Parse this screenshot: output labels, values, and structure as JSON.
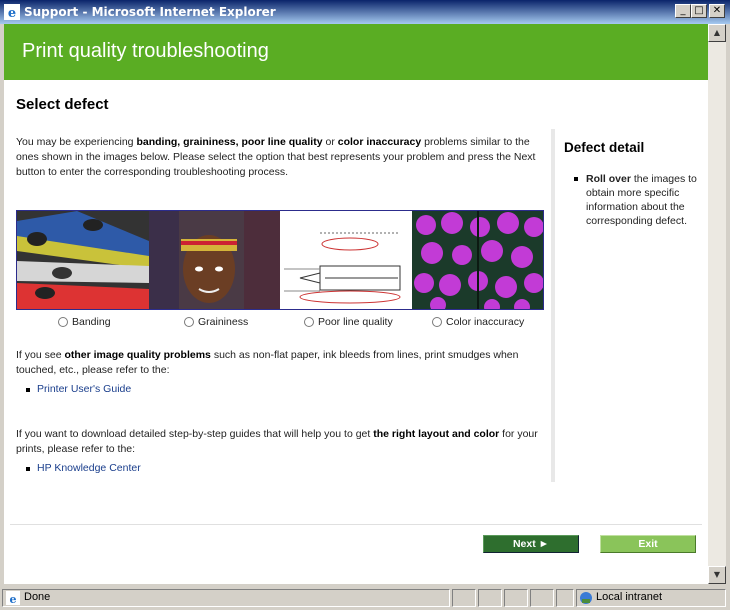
{
  "window": {
    "title": "Support - Microsoft Internet Explorer"
  },
  "header": {
    "title": "Print quality troubleshooting"
  },
  "section": {
    "title": "Select defect"
  },
  "intro": {
    "pre": "You may be experiencing ",
    "b1": "banding, graininess, poor line quality",
    "or": " or ",
    "b2": "color inaccuracy",
    "post": " problems similar to the ones shown in the images below. Please select the option that best represents your problem and press the Next button to enter the corresponding troubleshooting process."
  },
  "options": [
    {
      "label": "Banding"
    },
    {
      "label": "Graininess"
    },
    {
      "label": "Poor line quality"
    },
    {
      "label": "Color inaccuracy"
    }
  ],
  "other": {
    "pre": "If you see ",
    "bold": "other image quality problems",
    "post": " such as non-flat paper, ink bleeds from lines, print smudges when touched, etc., please refer to the:",
    "link": "Printer User's Guide"
  },
  "download": {
    "pre": "If you want to download detailed step-by-step guides that will help you to get ",
    "bold": "the right layout and color",
    "post": " for your prints, please refer to the:",
    "link": "HP Knowledge Center"
  },
  "detail": {
    "title": "Defect detail",
    "bold": "Roll over",
    "text": " the images to obtain more specific information about the corresponding defect."
  },
  "buttons": {
    "next": "Next ►",
    "exit": "Exit"
  },
  "status": {
    "text": "Done",
    "zone": "Local intranet"
  },
  "colors": {
    "header_green": "#5aad23",
    "next_green": "#2e6e2e",
    "exit_green": "#8ac45a",
    "link": "#1a3e8c"
  },
  "icons": [
    "ie-icon",
    "minimize-icon",
    "maximize-icon",
    "close-icon",
    "scroll-up-icon",
    "scroll-down-icon",
    "done-icon",
    "intranet-icon"
  ]
}
